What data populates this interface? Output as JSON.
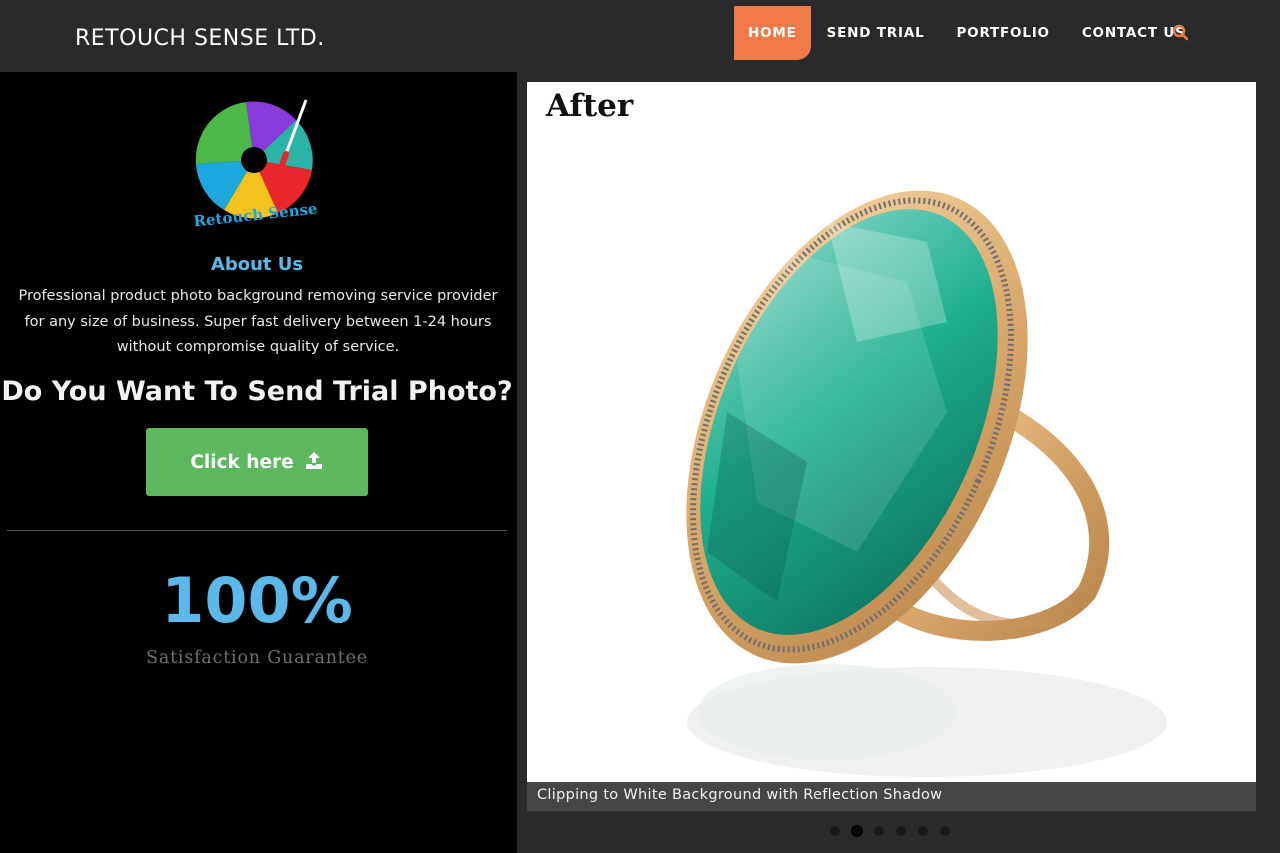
{
  "header": {
    "brand": "RETOUCH SENSE LTD.",
    "nav": [
      {
        "label": "HOME",
        "active": true
      },
      {
        "label": "SEND TRIAL",
        "active": false
      },
      {
        "label": "PORTFOLIO",
        "active": false
      },
      {
        "label": "CONTACT US",
        "active": false
      }
    ],
    "search_icon": "search-icon",
    "accent_color": "#f07a4a"
  },
  "sidebar": {
    "logo_text": "Retouch Sense",
    "about_title": "About Us",
    "about_text": "Professional product photo background removing service provider for any size of business. Super fast delivery between 1-24 hours without compromise quality of service.",
    "trial_question": "Do You Want To Send Trial Photo?",
    "cta_label": "Click here",
    "cta_icon": "upload-icon",
    "cta_color": "#5cb85c",
    "stat_value": "100%",
    "stat_label": "Satisfaction Guarantee",
    "stat_color": "#5bb8e8"
  },
  "slider": {
    "badge": "After",
    "caption": "Clipping to White Background with Reflection Shadow",
    "dot_count": 6,
    "active_dot": 2
  }
}
